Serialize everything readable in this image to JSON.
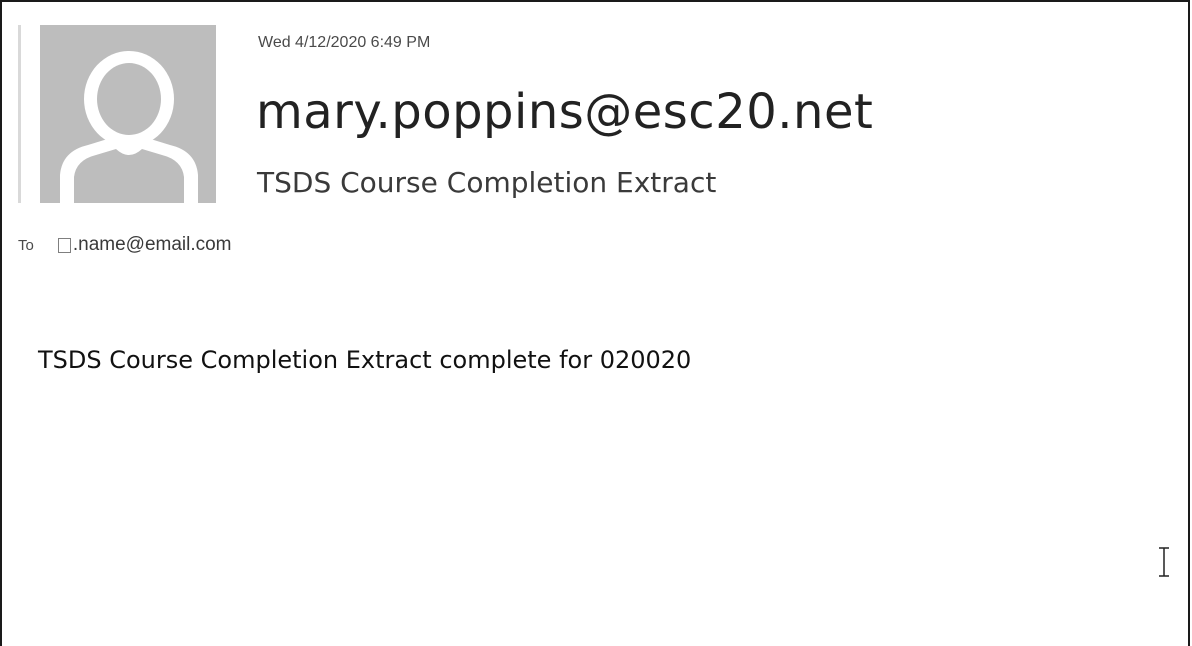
{
  "message": {
    "date": "Wed 4/12/2020 6:49 PM",
    "sender": "mary.poppins@esc20.net",
    "subject": "TSDS Course Completion Extract",
    "to_label": "To",
    "recipient": ".name@email.com",
    "body": "TSDS Course Completion Extract complete for 020020"
  },
  "icons": {
    "avatar": "person-placeholder-icon",
    "cursor": "text-cursor-icon",
    "recipient_checkbox": "checkbox-icon"
  },
  "colors": {
    "avatar_background": "#bdbdbd",
    "avatar_silhouette": "#ffffff",
    "frame_border": "#1a1a1a"
  }
}
